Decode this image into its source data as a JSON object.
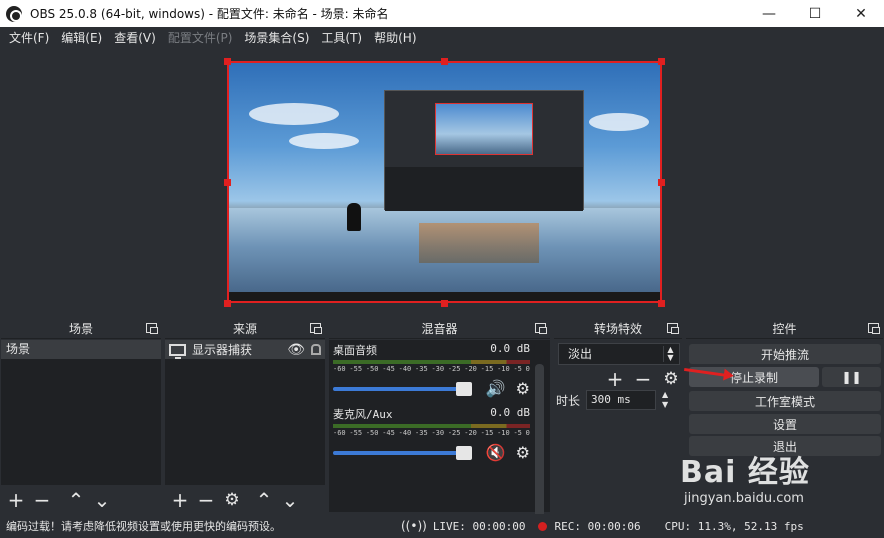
{
  "window": {
    "title": "OBS 25.0.8 (64-bit, windows) - 配置文件: 未命名 - 场景: 未命名",
    "minimize": "—",
    "maximize": "☐",
    "close": "✕"
  },
  "menu": [
    "文件(F)",
    "编辑(E)",
    "查看(V)",
    "配置文件(P)",
    "场景集合(S)",
    "工具(T)",
    "帮助(H)"
  ],
  "panels": {
    "scenes": {
      "title": "场景",
      "items": [
        "场景"
      ]
    },
    "sources": {
      "title": "来源",
      "items": [
        {
          "label": "显示器捕获",
          "icon": "monitor-icon"
        }
      ]
    },
    "mixer": {
      "title": "混音器",
      "channels": [
        {
          "name": "桌面音频",
          "level": "0.0 dB",
          "muted": false
        },
        {
          "name": "麦克风/Aux",
          "level": "0.0 dB",
          "muted": true
        }
      ],
      "ticks": [
        "-60",
        "-55",
        "-50",
        "-45",
        "-40",
        "-35",
        "-30",
        "-25",
        "-20",
        "-15",
        "-10",
        "-5",
        "0"
      ],
      "volume_fraction": 1.0
    },
    "transitions": {
      "title": "转场特效",
      "selected": "淡出",
      "duration_label": "时长",
      "duration_value": "300 ms"
    },
    "controls": {
      "title": "控件",
      "start_streaming": "开始推流",
      "stop_recording": "停止录制",
      "pause": "❚❚",
      "studio_mode": "工作室模式",
      "settings": "设置",
      "exit": "退出"
    }
  },
  "status": {
    "warning": "编码过载！请考虑降低视频设置或使用更快的编码预设。",
    "live": "LIVE: 00:00:00",
    "rec": "REC: 00:00:06",
    "cpu": "CPU: 11.3%, 52.13 fps"
  },
  "watermark": {
    "main": "Bai 经验",
    "sub": "jingyan.baidu.com"
  },
  "colors": {
    "accent": "#3c7ad6",
    "selection_border": "#e02020",
    "rec": "#d42020"
  }
}
